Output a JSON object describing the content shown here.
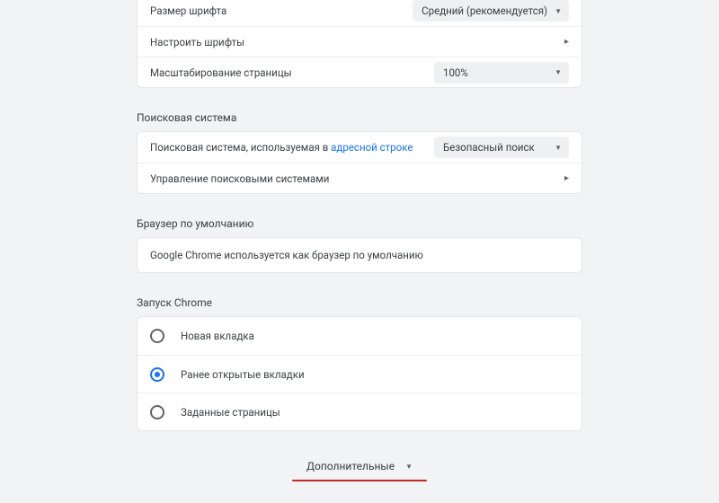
{
  "appearance": {
    "font_size_label": "Размер шрифта",
    "font_size_value": "Средний (рекомендуется)",
    "customize_fonts_label": "Настроить шрифты",
    "page_zoom_label": "Масштабирование страницы",
    "page_zoom_value": "100%"
  },
  "search_engine": {
    "section_title": "Поисковая система",
    "row1_prefix": "Поисковая система, используемая в ",
    "row1_link": "адресной строке",
    "row1_value": "Безопасный поиск",
    "manage_label": "Управление поисковыми системами"
  },
  "default_browser": {
    "section_title": "Браузер по умолчанию",
    "info": "Google Chrome используется как браузер по умолчанию"
  },
  "startup": {
    "section_title": "Запуск Chrome",
    "options": [
      {
        "label": "Новая вкладка",
        "checked": false
      },
      {
        "label": "Ранее открытые вкладки",
        "checked": true
      },
      {
        "label": "Заданные страницы",
        "checked": false
      }
    ]
  },
  "advanced_label": "Дополнительные"
}
